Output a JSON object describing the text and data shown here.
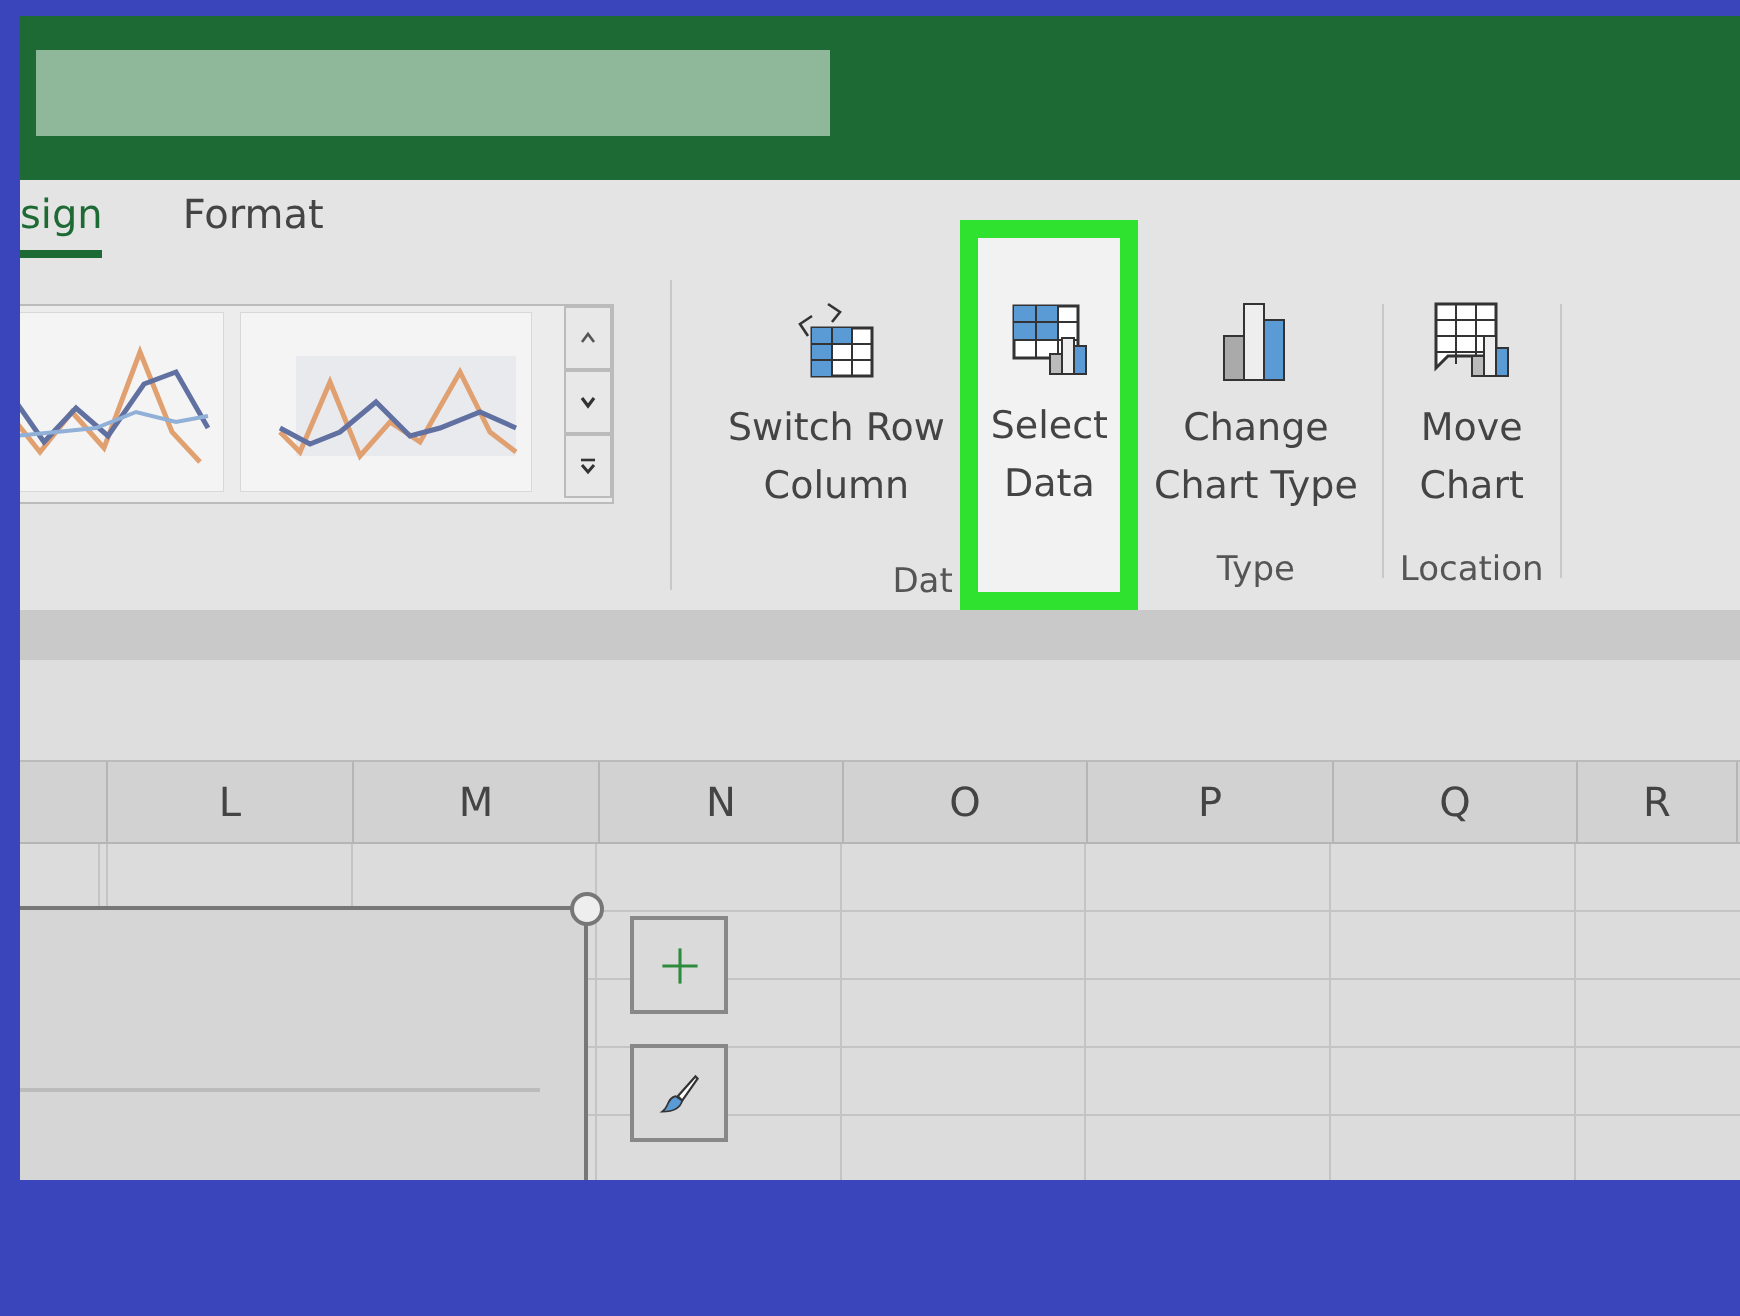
{
  "tabs": [
    {
      "label": "sign",
      "selected": true
    },
    {
      "label": "Format",
      "selected": false
    }
  ],
  "ribbon_groups": [
    {
      "label": "Dat",
      "buttons": [
        {
          "kind": "switch",
          "lines": [
            "Switch Row",
            "Column"
          ],
          "highlighted": false
        },
        {
          "kind": "select",
          "lines": [
            "Select",
            "Data"
          ],
          "highlighted": true
        }
      ]
    },
    {
      "label": "Type",
      "buttons": [
        {
          "kind": "change",
          "lines": [
            "Change",
            "Chart Type"
          ],
          "highlighted": false
        }
      ]
    },
    {
      "label": "Location",
      "buttons": [
        {
          "kind": "move",
          "lines": [
            "Move",
            "Chart"
          ],
          "highlighted": false
        }
      ]
    }
  ],
  "columns": [
    "",
    "L",
    "M",
    "N",
    "O",
    "P",
    "Q",
    "R"
  ]
}
